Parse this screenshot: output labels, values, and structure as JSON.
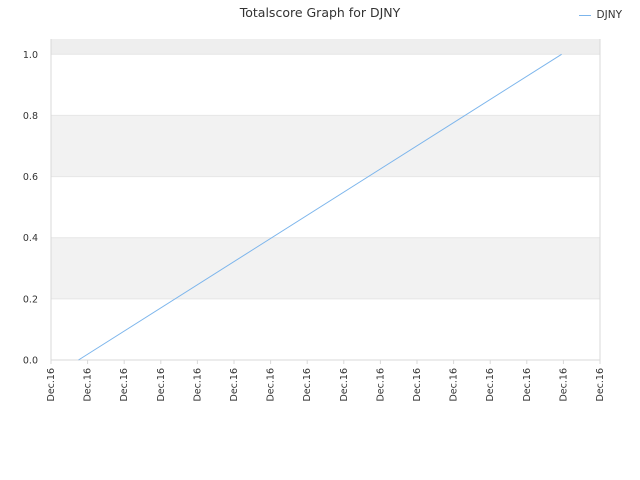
{
  "chart_data": {
    "type": "line",
    "title": "Totalscore Graph for DJNY",
    "xlabel": "",
    "ylabel": "",
    "ylim": [
      0,
      1.05
    ],
    "y_ticks": [
      "0.0",
      "0.2",
      "0.4",
      "0.6",
      "0.8",
      "1.0"
    ],
    "x_ticks": [
      "Dec.16",
      "Dec.16",
      "Dec.16",
      "Dec.16",
      "Dec.16",
      "Dec.16",
      "Dec.16",
      "Dec.16",
      "Dec.16",
      "Dec.16",
      "Dec.16",
      "Dec.16",
      "Dec.16",
      "Dec.16",
      "Dec.16",
      "Dec.16"
    ],
    "grid": true,
    "legend_position": "top-right",
    "series": [
      {
        "name": "DJNY",
        "color": "#7cb5ec",
        "x": [
          0.05,
          0.93
        ],
        "y": [
          0.0,
          1.0
        ]
      }
    ],
    "band_color": "#f2f2f2",
    "top_band_color": "#eeeeee",
    "grid_color": "#e6e6e6"
  }
}
